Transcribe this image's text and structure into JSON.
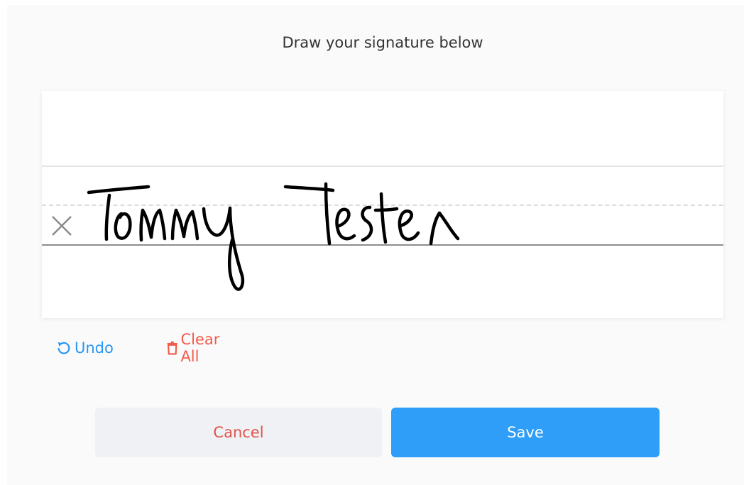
{
  "dialog": {
    "title": "Draw your signature below"
  },
  "signature_pad": {
    "signed_name": "Tommy Tester"
  },
  "toolbar": {
    "undo_label": "Undo",
    "clear_label": "Clear All",
    "undo_icon": "undo-icon",
    "clear_icon": "trash-icon",
    "undo_color": "#2b97f3",
    "clear_color": "#f25a4b"
  },
  "actions": {
    "cancel_label": "Cancel",
    "save_label": "Save",
    "save_color": "#2f9ef8",
    "cancel_color": "#e0554a"
  }
}
